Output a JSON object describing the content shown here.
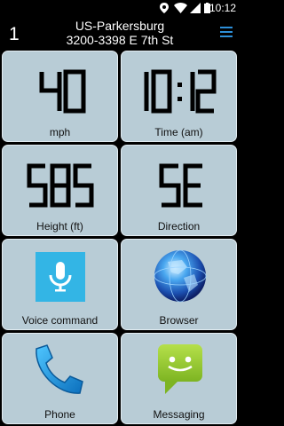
{
  "status_bar": {
    "time": "10:12"
  },
  "header": {
    "number": "1",
    "line1": "US-Parkersburg",
    "line2": "3200-3398 E 7th St"
  },
  "tiles": [
    {
      "value": "40",
      "label": "mph"
    },
    {
      "value": "10:12",
      "label": "Time (am)"
    },
    {
      "value": "585",
      "label": "Height (ft)"
    },
    {
      "value": "SE",
      "label": "Direction"
    },
    {
      "label": "Voice command",
      "icon": "microphone-icon"
    },
    {
      "label": "Browser",
      "icon": "globe-icon"
    },
    {
      "label": "Phone",
      "icon": "phone-icon"
    },
    {
      "label": "Messaging",
      "icon": "messaging-icon"
    }
  ]
}
